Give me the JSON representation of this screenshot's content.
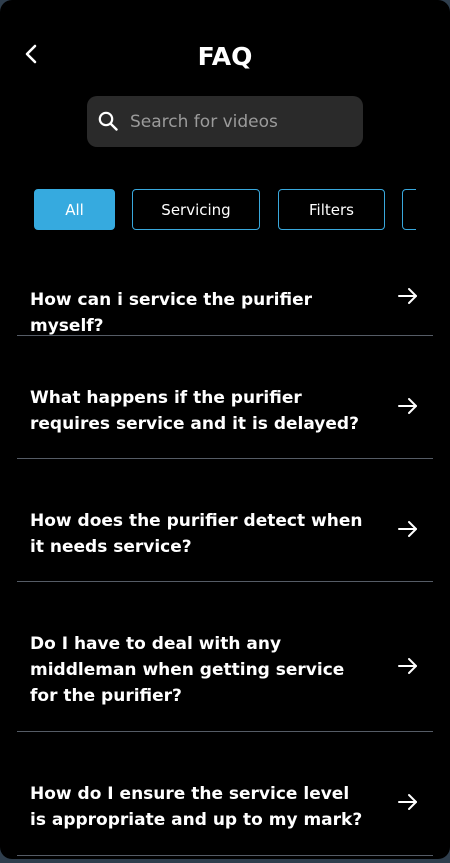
{
  "header": {
    "title": "FAQ"
  },
  "search": {
    "placeholder": "Search for videos",
    "value": ""
  },
  "filters": [
    {
      "label": "All",
      "active": true
    },
    {
      "label": "Servicing",
      "active": false
    },
    {
      "label": "Filters",
      "active": false
    },
    {
      "label": "",
      "active": false
    }
  ],
  "faqs": [
    {
      "question": "How can i service the purifier myself?"
    },
    {
      "question": "What happens if the purifier requires service and it is delayed?"
    },
    {
      "question": "How does the purifier detect when it needs service?"
    },
    {
      "question": "Do I have to deal with any middleman when getting service for the purifier?"
    },
    {
      "question": "How do I ensure the service level is appropriate and up to my mark?"
    }
  ],
  "colors": {
    "background": "#000000",
    "accent": "#36aadf",
    "divider": "#555c66",
    "search_bg": "#2a2a2a",
    "placeholder": "#9b9b9b"
  },
  "icons": {
    "back": "chevron-left-icon",
    "search": "search-icon",
    "row_arrow": "arrow-right-icon"
  }
}
